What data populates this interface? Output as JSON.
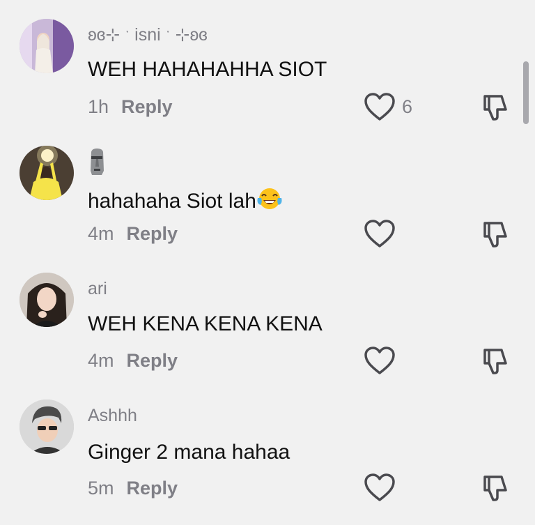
{
  "comments": [
    {
      "username": "ʚɞ⊹ ˑ isni ˑ ⊹ʚɞ",
      "text": "WEH HAHAHAHHA SIOT",
      "time": "1h",
      "reply_label": "Reply",
      "like_count": "6",
      "avatar_icon": "user-avatar"
    },
    {
      "username": "",
      "username_icon": "moai-emoji",
      "text": "hahahaha Siot lah",
      "text_emoji": "face-with-tears-of-joy-emoji",
      "time": "4m",
      "reply_label": "Reply",
      "like_count": "",
      "avatar_icon": "user-avatar"
    },
    {
      "username": "ari",
      "text": "WEH KENA KENA KENA",
      "time": "4m",
      "reply_label": "Reply",
      "like_count": "",
      "avatar_icon": "user-avatar"
    },
    {
      "username": "Ashhh",
      "text": "Ginger 2 mana hahaa",
      "time": "5m",
      "reply_label": "Reply",
      "like_count": "",
      "avatar_icon": "user-avatar"
    }
  ],
  "icons": {
    "like": "heart-outline-icon",
    "dislike": "thumbs-down-icon"
  },
  "colors": {
    "background": "#f1f1f1",
    "secondary_text": "#7f7f86",
    "primary_text": "#111111",
    "icon": "#4a4a4f"
  }
}
